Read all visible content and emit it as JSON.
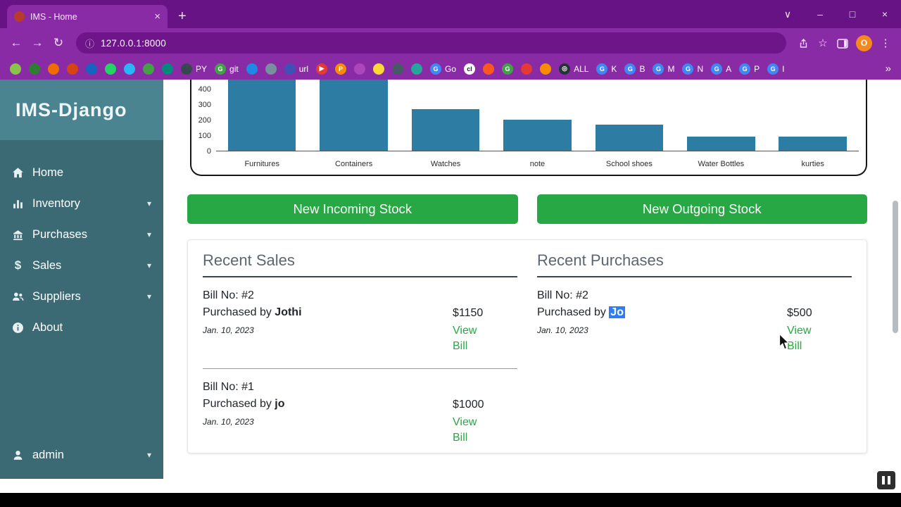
{
  "colors": {
    "chrome_frame": "#671386",
    "chrome_toolbar": "#8a2ba6",
    "sidebar": "#3b6a75",
    "sidebar_brand": "#4a8490",
    "accent_green": "#28a745",
    "selection_blue": "#2f7df6"
  },
  "icons": {
    "new_tab": "+",
    "tab_close": "×",
    "chevron_down": "∨",
    "minimize": "–",
    "maximize": "□",
    "window_close": "×",
    "back": "←",
    "forward": "→",
    "reload": "↻",
    "info": "ⓘ",
    "star": "☆",
    "menu_dots": "⋮",
    "overflow": "»",
    "caret_down": "▾"
  },
  "browser": {
    "tab_title": "IMS - Home",
    "url": "127.0.0.1:8000",
    "avatar_letter": "O",
    "bookmarks": [
      {
        "bg": "#8bc34a",
        "t": ""
      },
      {
        "bg": "#2e7d32",
        "t": ""
      },
      {
        "bg": "#ef6c00",
        "t": ""
      },
      {
        "bg": "#d84315",
        "t": ""
      },
      {
        "bg": "#1565c0",
        "t": ""
      },
      {
        "bg": "#25d366",
        "t": ""
      },
      {
        "bg": "#29b6f6",
        "t": ""
      },
      {
        "bg": "#43a047",
        "t": ""
      },
      {
        "bg": "#00897b",
        "t": ""
      },
      {
        "bg": "#37474f",
        "t": "",
        "label": "PY"
      },
      {
        "bg": "#43a047",
        "t": "G",
        "label": "git"
      },
      {
        "bg": "#1e88e5",
        "t": ""
      },
      {
        "bg": "#78909c",
        "t": ""
      },
      {
        "bg": "#3f51b5",
        "t": "",
        "label": "url"
      },
      {
        "bg": "#e53935",
        "t": "▶"
      },
      {
        "bg": "#fb8c00",
        "t": "P"
      },
      {
        "bg": "#ab47bc",
        "t": ""
      },
      {
        "bg": "#fdd835",
        "t": ""
      },
      {
        "bg": "#455a64",
        "t": ""
      },
      {
        "bg": "#26a69a",
        "t": ""
      },
      {
        "bg": "#4285f4",
        "t": "G",
        "label": "Go"
      },
      {
        "bg": "#ffffff",
        "t": "cl",
        "fg": "#222222"
      },
      {
        "bg": "#ff5722",
        "t": ""
      },
      {
        "bg": "#43a047",
        "t": "G"
      },
      {
        "bg": "#e53935",
        "t": ""
      },
      {
        "bg": "#fb8c00",
        "t": ""
      },
      {
        "bg": "#263238",
        "t": "◎",
        "label": "ALL"
      },
      {
        "bg": "#4285f4",
        "t": "G",
        "label": "K"
      },
      {
        "bg": "#4285f4",
        "t": "G",
        "label": "B"
      },
      {
        "bg": "#4285f4",
        "t": "G",
        "label": "M"
      },
      {
        "bg": "#4285f4",
        "t": "G",
        "label": "N"
      },
      {
        "bg": "#4285f4",
        "t": "G",
        "label": "A"
      },
      {
        "bg": "#4285f4",
        "t": "G",
        "label": "P"
      },
      {
        "bg": "#4285f4",
        "t": "G",
        "label": "I"
      }
    ]
  },
  "sidebar": {
    "brand": "IMS-Django",
    "items": [
      {
        "label": "Home",
        "caret": false
      },
      {
        "label": "Inventory",
        "caret": true
      },
      {
        "label": "Purchases",
        "caret": true
      },
      {
        "label": "Sales",
        "caret": true
      },
      {
        "label": "Suppliers",
        "caret": true
      },
      {
        "label": "About",
        "caret": false
      }
    ],
    "footer": {
      "label": "admin"
    }
  },
  "chart_data": {
    "type": "bar",
    "categories": [
      "Furnitures",
      "Containers",
      "Watches",
      "note",
      "School shoes",
      "Water Bottles",
      "kurties"
    ],
    "values": [
      500,
      500,
      270,
      200,
      170,
      90,
      90
    ],
    "title": "",
    "xlabel": "",
    "ylabel": "",
    "ylim": [
      0,
      450
    ],
    "yticks": [
      0,
      100,
      200,
      300,
      400
    ],
    "bar_color": "#2d7ca3",
    "grid": false,
    "note_top_cropped": true
  },
  "actions": {
    "incoming_label": "New Incoming Stock",
    "outgoing_label": "New Outgoing Stock"
  },
  "recent_sales": {
    "title": "Recent Sales",
    "items": [
      {
        "bill": "Bill No: #2",
        "purchased_prefix": "Purchased by",
        "buyer": "Jothi",
        "date": "Jan. 10, 2023",
        "amount": "$1150",
        "link": "View Bill"
      },
      {
        "bill": "Bill No: #1",
        "purchased_prefix": "Purchased by",
        "buyer": "jo",
        "date": "Jan. 10, 2023",
        "amount": "$1000",
        "link": "View Bill"
      }
    ]
  },
  "recent_purchases": {
    "title": "Recent Purchases",
    "items": [
      {
        "bill": "Bill No: #2",
        "purchased_prefix": "Purchased by",
        "buyer": "Jo",
        "date": "Jan. 10, 2023",
        "amount": "$500",
        "link": "View Bill"
      }
    ]
  }
}
